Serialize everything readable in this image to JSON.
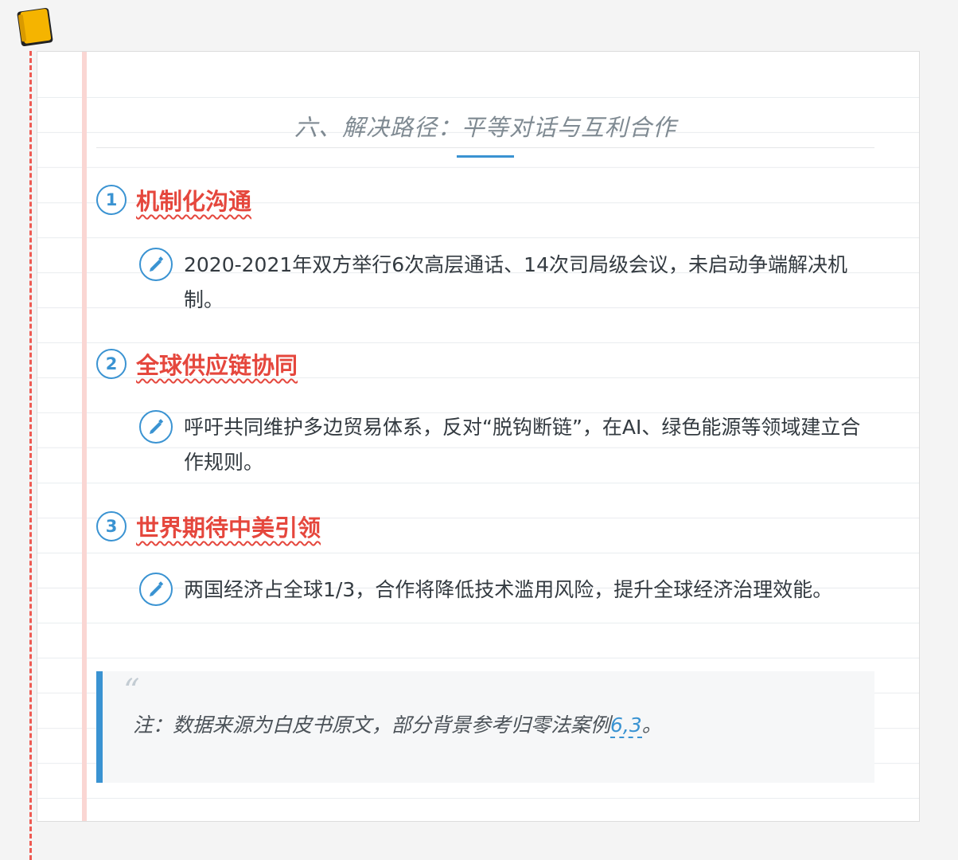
{
  "document": {
    "section_title": "六、解决路径：平等对话与互利合作",
    "items": [
      {
        "number": "1",
        "title": "机制化沟通",
        "text": "2020-2021年双方举行6次高层通话、14次司局级会议，未启动争端解决机制。"
      },
      {
        "number": "2",
        "title": "全球供应链协同",
        "text": "呼吁共同维护多边贸易体系，反对“脱钩断链”，在AI、绿色能源等领域建立合作规则。"
      },
      {
        "number": "3",
        "title": "世界期待中美引领",
        "text": "两国经济占全球1/3，合作将降低技术滥用风险，提升全球经济治理效能。"
      }
    ],
    "note": {
      "quote_mark": "“",
      "text": "注：数据来源为白皮书原文，部分背景参考归零法案例",
      "citation": "6,3",
      "end": "。"
    }
  },
  "icons": {
    "corner": "notebook-icon",
    "bullet": "pencil-icon"
  },
  "colors": {
    "accent_blue": "#3a93d2",
    "heading_red": "#e5473d",
    "margin_dash_red": "#ee5a52",
    "notebook_yellow": "#f5b400"
  }
}
